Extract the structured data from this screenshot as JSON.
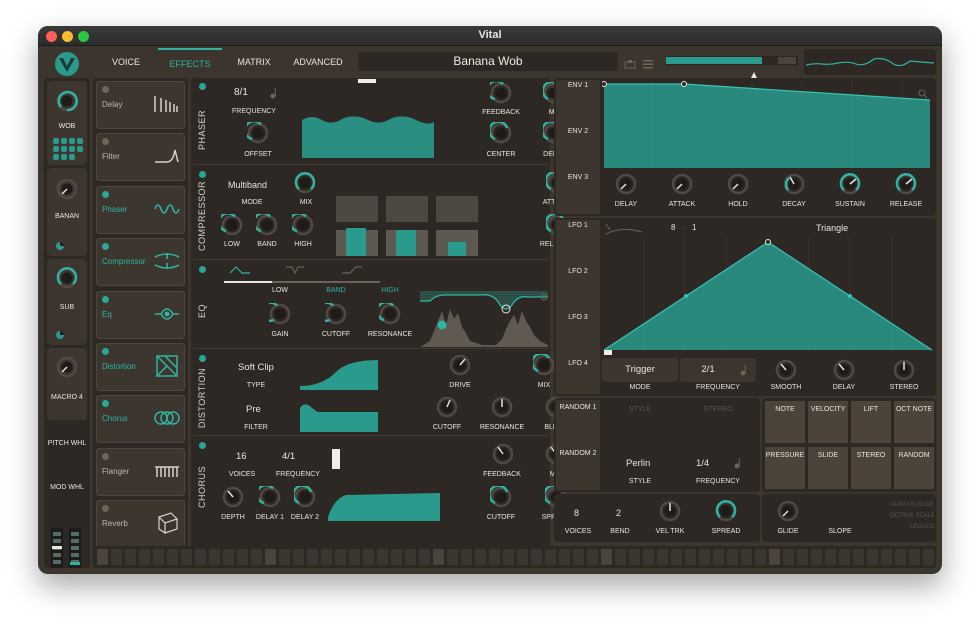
{
  "window": {
    "title": "Vital"
  },
  "nav": {
    "tabs": [
      "VOICE",
      "EFFECTS",
      "MATRIX",
      "ADVANCED"
    ],
    "active": "EFFECTS"
  },
  "preset": {
    "name": "Banana Wob"
  },
  "macros": [
    "WOB",
    "BANAN",
    "SUB",
    "MACRO 4"
  ],
  "wheels": {
    "pitch": "PITCH WHL",
    "mod": "MOD WHL"
  },
  "fx_list": [
    {
      "name": "Delay",
      "enabled": false
    },
    {
      "name": "Filter",
      "enabled": false
    },
    {
      "name": "Phaser",
      "enabled": true
    },
    {
      "name": "Compressor",
      "enabled": true
    },
    {
      "name": "Eq",
      "enabled": true
    },
    {
      "name": "Distortion",
      "enabled": true
    },
    {
      "name": "Chorus",
      "enabled": true
    },
    {
      "name": "Flanger",
      "enabled": false
    },
    {
      "name": "Reverb",
      "enabled": false
    }
  ],
  "phaser": {
    "section": "PHASER",
    "freq_value": "8/1",
    "freq_label": "FREQUENCY",
    "offset": "OFFSET",
    "feedback": "FEEDBACK",
    "mix": "MIX",
    "center": "CENTER",
    "depth": "DEPTH"
  },
  "compressor": {
    "section": "COMPRESSOR",
    "mode_value": "Multiband",
    "mode_label": "MODE",
    "mix": "MIX",
    "attack": "ATTACK",
    "low": "LOW",
    "band": "BAND",
    "high": "HIGH",
    "release": "RELEASE"
  },
  "eq": {
    "section": "EQ",
    "bands": [
      "LOW",
      "BAND",
      "HIGH"
    ],
    "gain": "GAIN",
    "cutoff": "CUTOFF",
    "resonance": "RESONANCE"
  },
  "distortion": {
    "section": "DISTORTION",
    "type_value": "Soft Clip",
    "type_label": "TYPE",
    "drive": "DRIVE",
    "mix": "MIX",
    "filter_value": "Pre",
    "filter_label": "FILTER",
    "cutoff": "CUTOFF",
    "resonance": "RESONANCE",
    "blend": "BLEND"
  },
  "chorus": {
    "section": "CHORUS",
    "voices_value": "16",
    "voices_label": "VOICES",
    "freq_value": "4/1",
    "freq_label": "FREQUENCY",
    "feedback": "FEEDBACK",
    "mix": "MIX",
    "depth": "DEPTH",
    "delay1": "DELAY 1",
    "delay2": "DELAY 2",
    "cutoff": "CUTOFF",
    "spread": "SPREAD"
  },
  "env": {
    "tabs": [
      "ENV 1",
      "ENV 2",
      "ENV 3"
    ],
    "knobs": [
      "DELAY",
      "ATTACK",
      "HOLD",
      "DECAY",
      "SUSTAIN",
      "RELEASE"
    ]
  },
  "lfo": {
    "tabs": [
      "LFO 1",
      "LFO 2",
      "LFO 3",
      "LFO 4"
    ],
    "grid_x": "8",
    "grid_y": "1",
    "shape": "Triangle",
    "mode_value": "Trigger",
    "mode_label": "MODE",
    "freq_value": "2/1",
    "freq_label": "FREQUENCY",
    "smooth": "SMOOTH",
    "delay": "DELAY",
    "stereo": "STEREO"
  },
  "random": {
    "tabs": [
      "RANDOM 1",
      "RANDOM 2"
    ],
    "faint": [
      "STYLE",
      "STEREO"
    ],
    "style_value": "Perlin",
    "style_label": "STYLE",
    "freq_value": "1/4",
    "freq_label": "FREQUENCY"
  },
  "mod_sources": [
    "NOTE",
    "VELOCITY",
    "LIFT",
    "OCT NOTE",
    "PRESSURE",
    "SLIDE",
    "STEREO",
    "RANDOM"
  ],
  "voice": {
    "voices_value": "8",
    "voices_label": "VOICES",
    "bend_value": "2",
    "bend_label": "BEND",
    "veltrk": "VEL TRK",
    "spread": "SPREAD",
    "glide": "GLIDE",
    "slope": "SLOPE",
    "options": [
      "ALWAYS GLIDE",
      "OCTAVE SCALE",
      "LEGATO"
    ]
  },
  "colors": {
    "accent": "#2a9a8d",
    "panel": "#2d2824",
    "background": "#3b352d"
  }
}
